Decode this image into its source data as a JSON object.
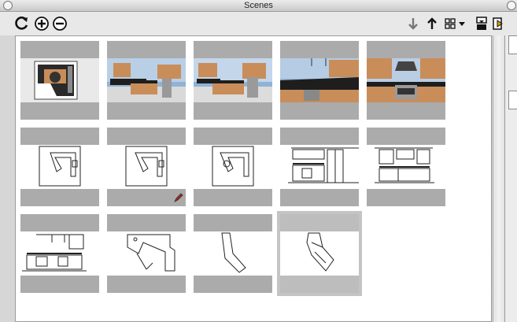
{
  "window": {
    "title": "Scenes"
  },
  "toolbar": {
    "left_icons": [
      "refresh-icon",
      "add-scene-icon",
      "remove-scene-icon"
    ],
    "right_icons": [
      "move-scene-down-icon",
      "move-scene-up-icon",
      "view-options-icon",
      "show-details-icon",
      "details-panel-icon"
    ]
  },
  "scenes": [
    {
      "label": "",
      "kind": "render-top"
    },
    {
      "label": "",
      "kind": "render-persp"
    },
    {
      "label": "",
      "kind": "render-persp"
    },
    {
      "label": "",
      "kind": "render-counter"
    },
    {
      "label": "",
      "kind": "render-stove"
    },
    {
      "label": "",
      "kind": "plan-l"
    },
    {
      "label": "",
      "kind": "plan-l",
      "edit_indicator": true
    },
    {
      "label": "",
      "kind": "plan-l"
    },
    {
      "label": "",
      "kind": "elev-1"
    },
    {
      "label": "",
      "kind": "elev-2"
    },
    {
      "label": "",
      "kind": "elev-3"
    },
    {
      "label": "",
      "kind": "outline-l"
    },
    {
      "label": "",
      "kind": "outline-bent"
    },
    {
      "label": "",
      "kind": "outline-diamond",
      "selected": true
    }
  ],
  "colors": {
    "thumb_bar": "#ababab",
    "selection": "#c4c4c4",
    "wood": "#c98d5a",
    "counter": "#1e1e1e"
  }
}
